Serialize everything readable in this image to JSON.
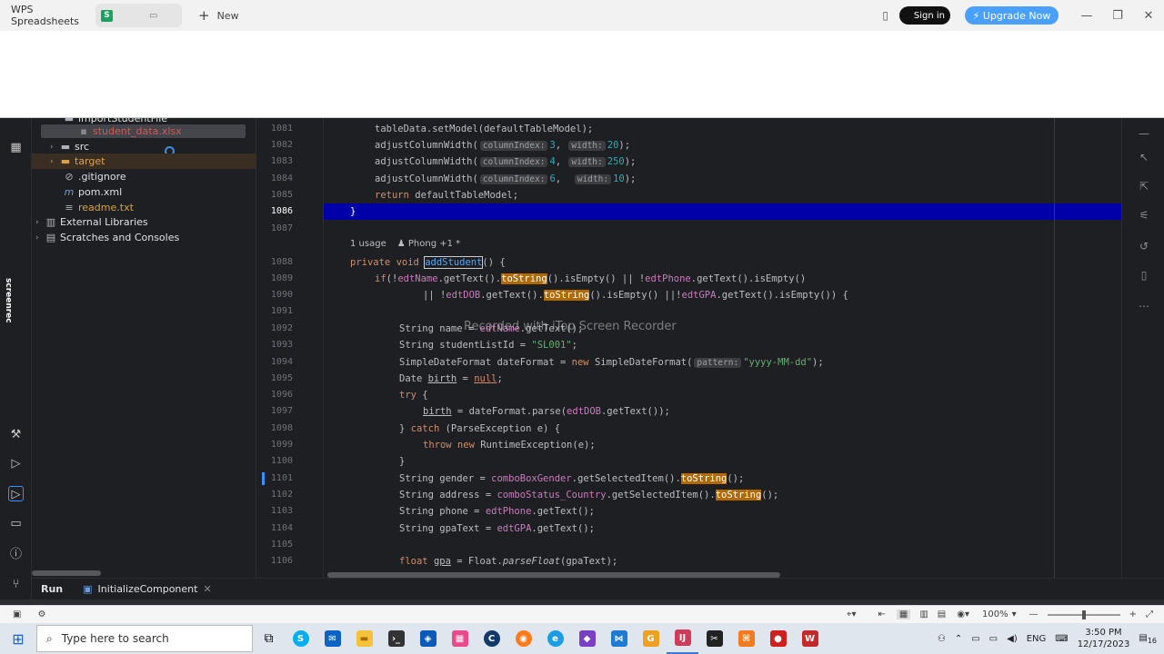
{
  "wps": {
    "app_tab": "WPS Spreadsheets",
    "new_label": "New",
    "signin": "Sign in",
    "upgrade": "Upgrade Now"
  },
  "left_strip": {
    "brand": "screenrec"
  },
  "tree": {
    "items": [
      {
        "label": "importStudentFile",
        "color": "#dfe1e5"
      },
      {
        "label": "student_data.xlsx",
        "color": "#cf5b56"
      },
      {
        "label": "src",
        "color": "#dfe1e5"
      },
      {
        "label": "target",
        "color": "#d9a343"
      },
      {
        "label": ".gitignore",
        "color": "#dfe1e5"
      },
      {
        "label": "pom.xml",
        "color": "#dfe1e5"
      },
      {
        "label": "readme.txt",
        "color": "#d9a343"
      },
      {
        "label": "External Libraries",
        "color": "#dfe1e5"
      },
      {
        "label": "Scratches and Consoles",
        "color": "#dfe1e5"
      }
    ]
  },
  "editor": {
    "line_numbers": [
      "1081",
      "1082",
      "1083",
      "1084",
      "1085",
      "1086",
      "1087",
      "1088",
      "1089",
      "1090",
      "1091",
      "1092",
      "1093",
      "1094",
      "1095",
      "1096",
      "1097",
      "1098",
      "1099",
      "1100",
      "1101",
      "1102",
      "1103",
      "1104",
      "1105",
      "1106"
    ],
    "usage_count": "1 usage",
    "usage_author": "Phong +1 *",
    "watermark": "Recorded with iTop Screen Recorder",
    "hints": {
      "columnIndex": "columnIndex:",
      "width": "width:",
      "pattern": "pattern:"
    }
  },
  "bottom": {
    "run_tab": "Run",
    "config_tab": "InitializeComponent",
    "zoom": "100%"
  },
  "taskbar": {
    "search_placeholder": "Type here to search",
    "lang": "ENG",
    "time": "3:50 PM",
    "date": "12/17/2023",
    "notif_count": "16"
  }
}
